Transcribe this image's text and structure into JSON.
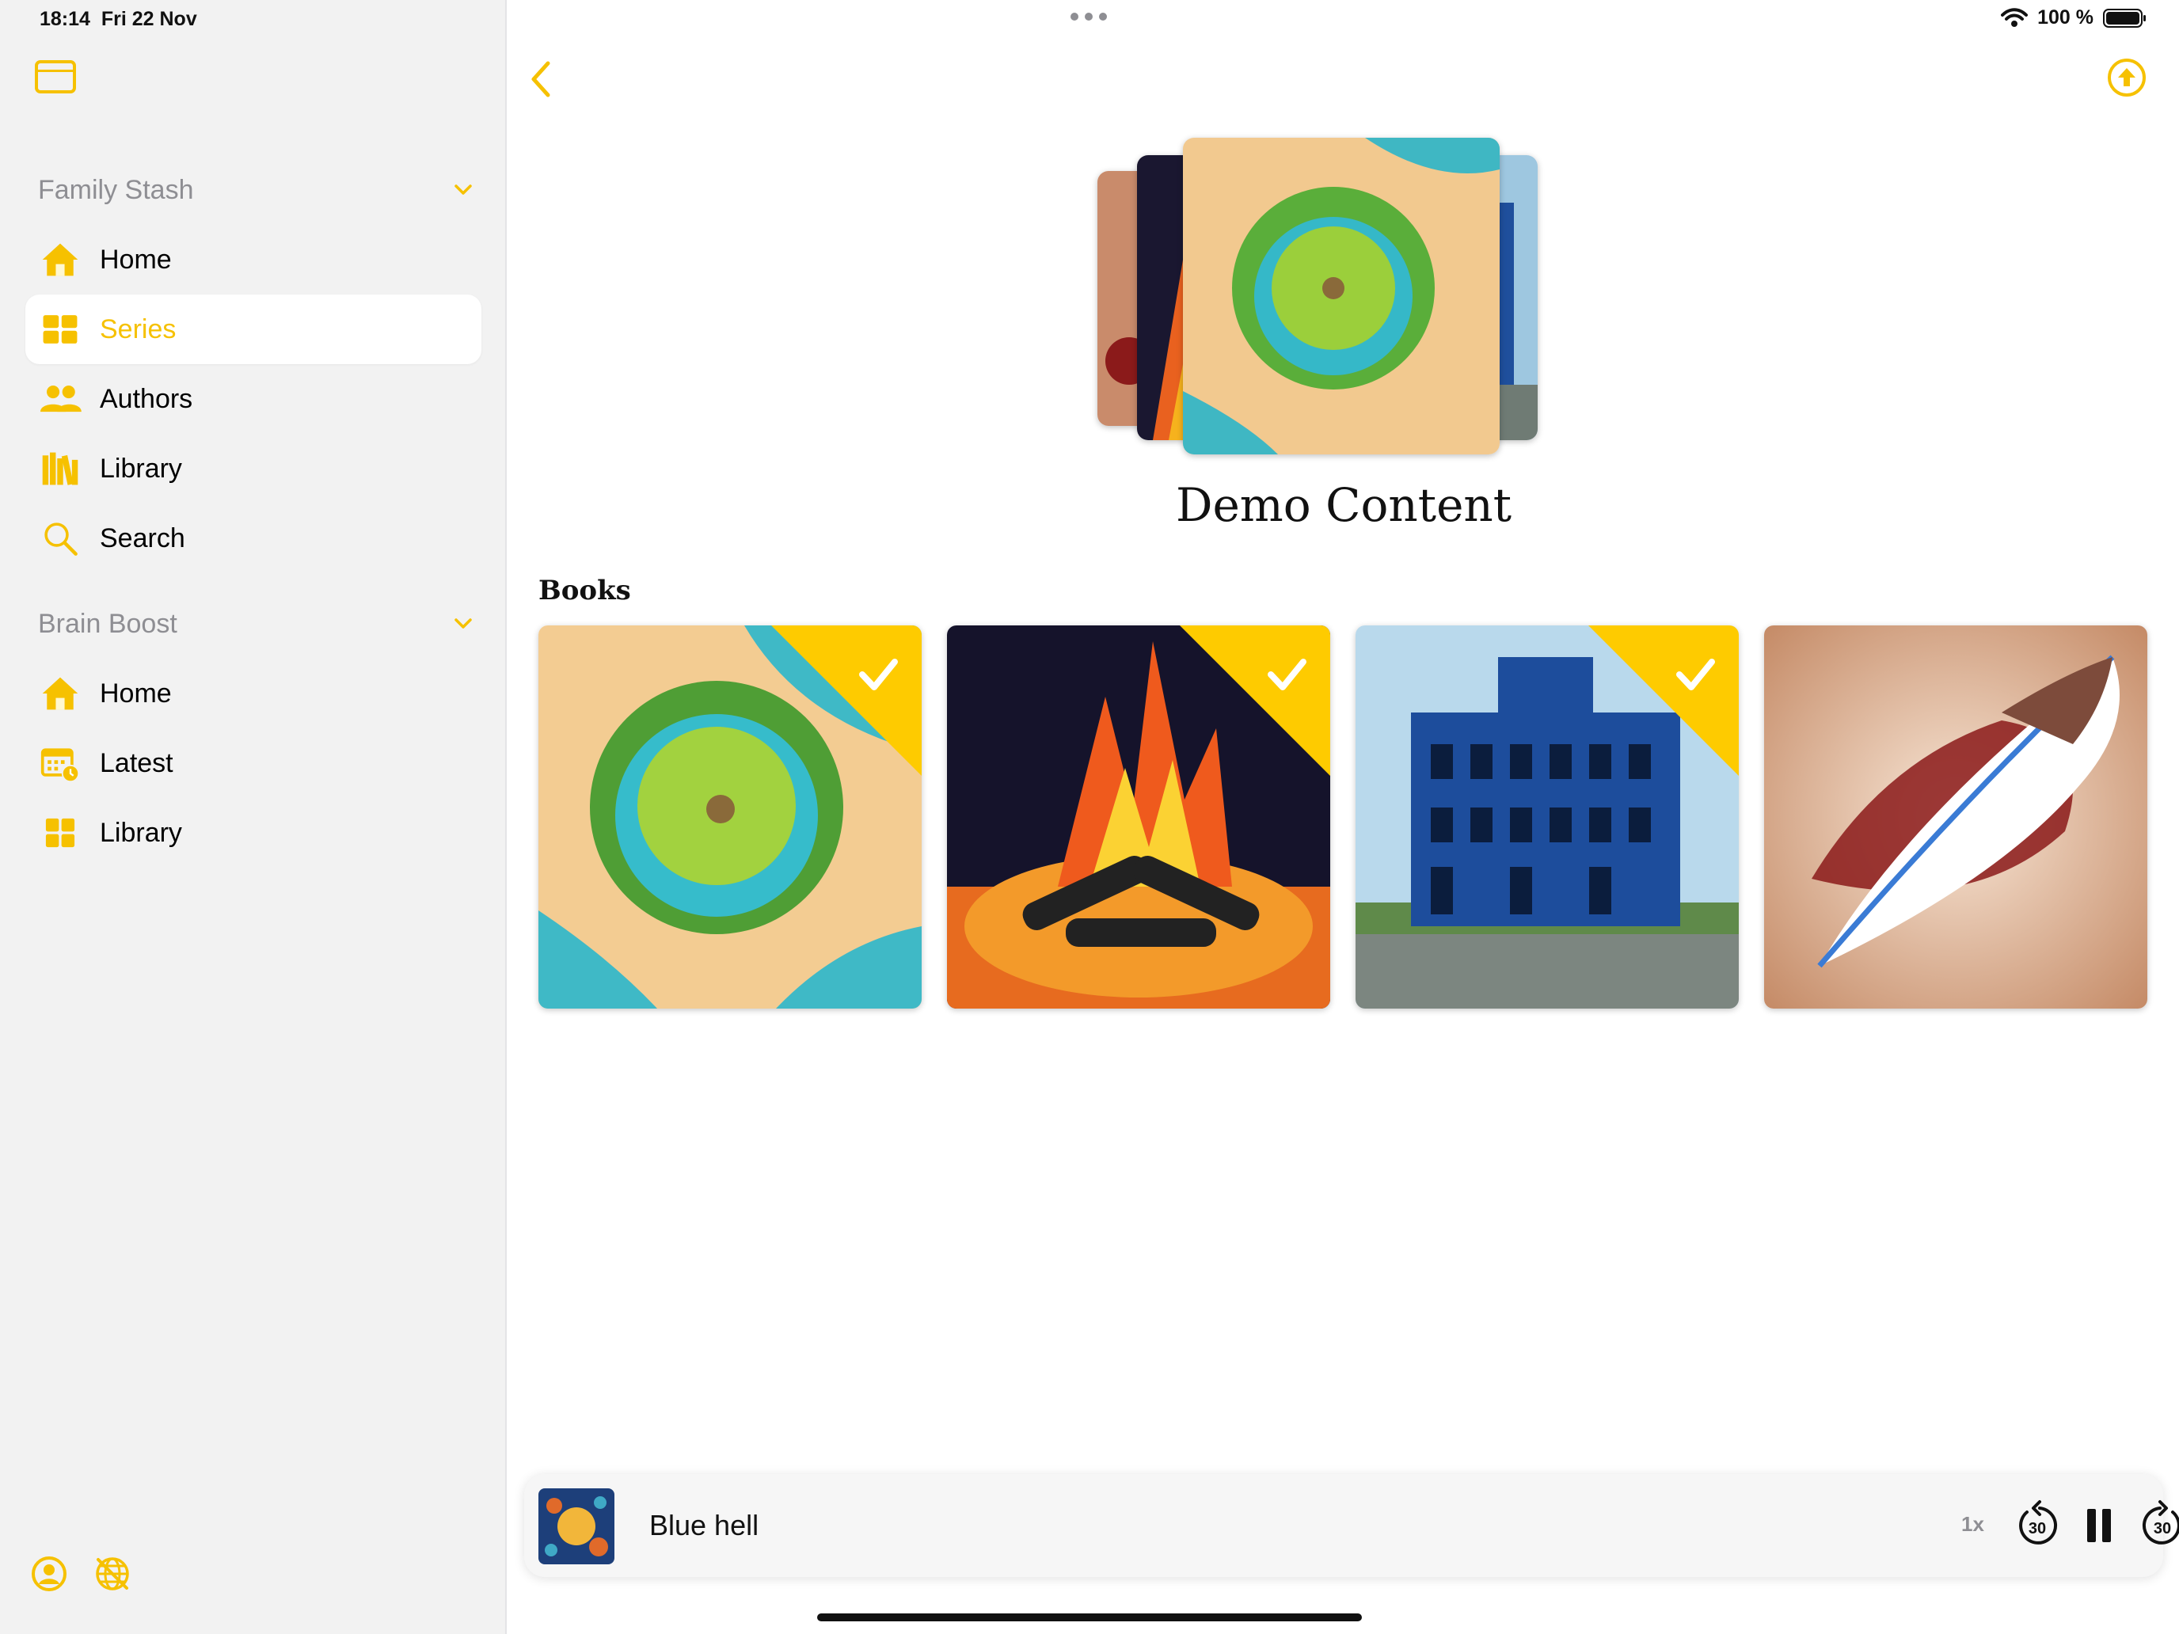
{
  "status_bar": {
    "time": "18:14",
    "date": "Fri 22 Nov",
    "battery": "100 %"
  },
  "sidebar": {
    "sections": [
      {
        "title": "Family Stash",
        "items": [
          {
            "label": "Home",
            "icon": "house-icon",
            "active": false
          },
          {
            "label": "Series",
            "icon": "grid-icon",
            "active": true
          },
          {
            "label": "Authors",
            "icon": "people-icon",
            "active": false
          },
          {
            "label": "Library",
            "icon": "books-icon",
            "active": false
          },
          {
            "label": "Search",
            "icon": "magnifier-icon",
            "active": false
          }
        ]
      },
      {
        "title": "Brain Boost",
        "items": [
          {
            "label": "Home",
            "icon": "house-icon",
            "active": false
          },
          {
            "label": "Latest",
            "icon": "calendar-clock-icon",
            "active": false
          },
          {
            "label": "Library",
            "icon": "grid-icon",
            "active": false
          }
        ]
      }
    ],
    "bottom_icons": [
      "account-icon",
      "offline-icon"
    ]
  },
  "main": {
    "series_title": "Demo Content",
    "books_heading": "Books",
    "books": [
      {
        "art": "island",
        "finished": true
      },
      {
        "art": "campfire",
        "finished": true
      },
      {
        "art": "blue-building",
        "finished": true
      },
      {
        "art": "feather",
        "finished": false
      }
    ]
  },
  "player": {
    "title": "Blue hell",
    "speed": "1x",
    "skip_seconds": "30",
    "state": "playing"
  },
  "colors": {
    "accent": "#f6c100",
    "sidebar_bg": "#f2f2f2",
    "badge": "#fecb00"
  }
}
